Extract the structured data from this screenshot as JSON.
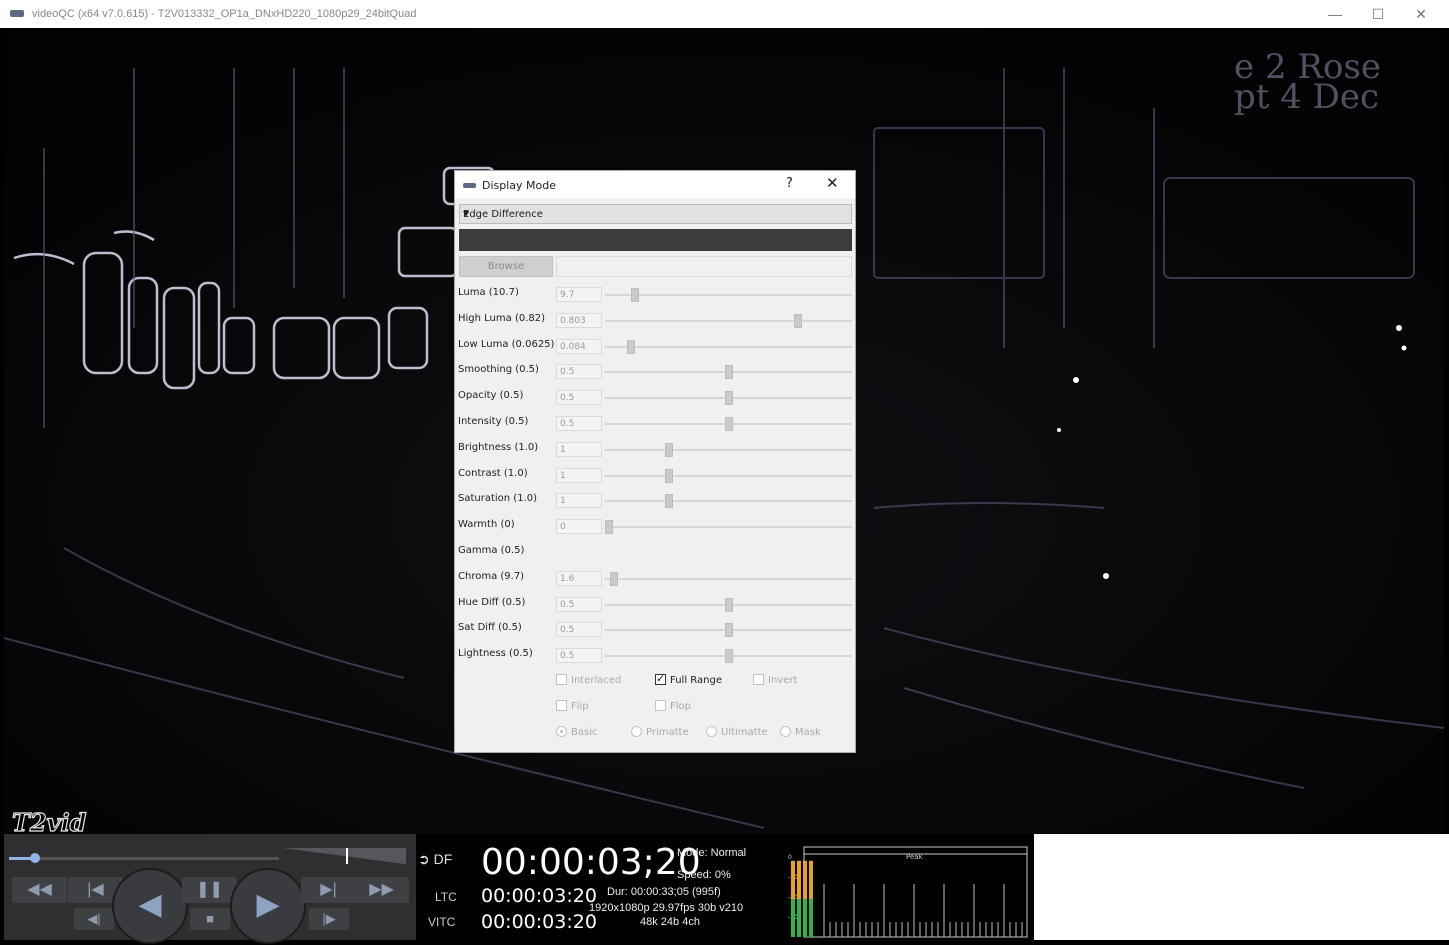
{
  "window": {
    "title": "videoQC (x64 v7.0.615) - T2V013332_OP1a_DNxHD220_1080p29_24bitQuad",
    "minimize": "—",
    "maximize": "☐",
    "close": "✕"
  },
  "video": {
    "watermark": "T2vid"
  },
  "dialog": {
    "title": "Display Mode",
    "help": "?",
    "close": "✕",
    "mode": "Edge Difference",
    "browse_label": "Browse",
    "params": [
      {
        "label": "Luma (10.7)",
        "value": "9.7",
        "level": 0.11
      },
      {
        "label": "High Luma (0.82)",
        "value": "0.803",
        "level": 0.79
      },
      {
        "label": "Low Luma (0.0625)",
        "value": "0.084",
        "level": 0.09
      },
      {
        "label": "Smoothing (0.5)",
        "value": "0.5",
        "level": 0.5
      },
      {
        "label": "Opacity (0.5)",
        "value": "0.5",
        "level": 0.5
      },
      {
        "label": "Intensity (0.5)",
        "value": "0.5",
        "level": 0.5
      },
      {
        "label": "Brightness (1.0)",
        "value": "1",
        "level": 0.25
      },
      {
        "label": "Contrast (1.0)",
        "value": "1",
        "level": 0.25
      },
      {
        "label": "Saturation (1.0)",
        "value": "1",
        "level": 0.25
      },
      {
        "label": "Warmth (0)",
        "value": "0",
        "level": 0.0
      },
      {
        "label": "Gamma (0.5)",
        "value": "",
        "level": null
      },
      {
        "label": "Chroma (9.7)",
        "value": "1.6",
        "level": 0.02
      },
      {
        "label": "Hue Diff (0.5)",
        "value": "0.5",
        "level": 0.5
      },
      {
        "label": "Sat Diff (0.5)",
        "value": "0.5",
        "level": 0.5
      },
      {
        "label": "Lightness (0.5)",
        "value": "0.5",
        "level": 0.5
      }
    ],
    "checkboxes": {
      "interlaced": {
        "label": "Interlaced",
        "checked": false
      },
      "full_range": {
        "label": "Full Range",
        "checked": true
      },
      "invert": {
        "label": "Invert",
        "checked": false
      },
      "flip": {
        "label": "Flip",
        "checked": false
      },
      "flop": {
        "label": "Flop",
        "checked": false
      }
    },
    "radios": {
      "basic": {
        "label": "Basic",
        "selected": true
      },
      "primatte": {
        "label": "Primatte",
        "selected": false
      },
      "ultimatte": {
        "label": "Ultimatte",
        "selected": false
      },
      "mask": {
        "label": "Mask",
        "selected": false
      }
    }
  },
  "transport": {
    "position_level": 0.09,
    "rewind": "◀◀",
    "to_start": "|◀",
    "play_reverse": "◀",
    "pause": "❚❚",
    "play": "▶",
    "to_end": "▶|",
    "fast_forward": "▶▶",
    "step_back": "◀|",
    "stop": "■",
    "step_forward": "|▶"
  },
  "timecode": {
    "df_label": "DF",
    "main": "00:00:03;20",
    "mode": "Mode: Normal",
    "speed": "Speed: 0%",
    "ltc_label": "LTC",
    "ltc": "00:00:03:20",
    "vitc_label": "VITC",
    "vitc": "00:00:03:20",
    "duration": "Dur: 00:00:33;05 (995f)",
    "format": "1920x1080p 29.97fps 30b v210",
    "audio_format": "48k 24b 4ch"
  },
  "audio_meter": {
    "title": "Peak",
    "scale": [
      "0",
      "-10",
      "-20",
      "-30"
    ],
    "channels": [
      {
        "level": 0.94,
        "color": "#2fb34a"
      },
      {
        "level": 0.94,
        "color": "#2fb34a"
      },
      {
        "level": 0.94,
        "color": "#2fb34a"
      },
      {
        "level": 0.94,
        "color": "#2fb34a"
      }
    ],
    "accent": "#e8a21c"
  }
}
